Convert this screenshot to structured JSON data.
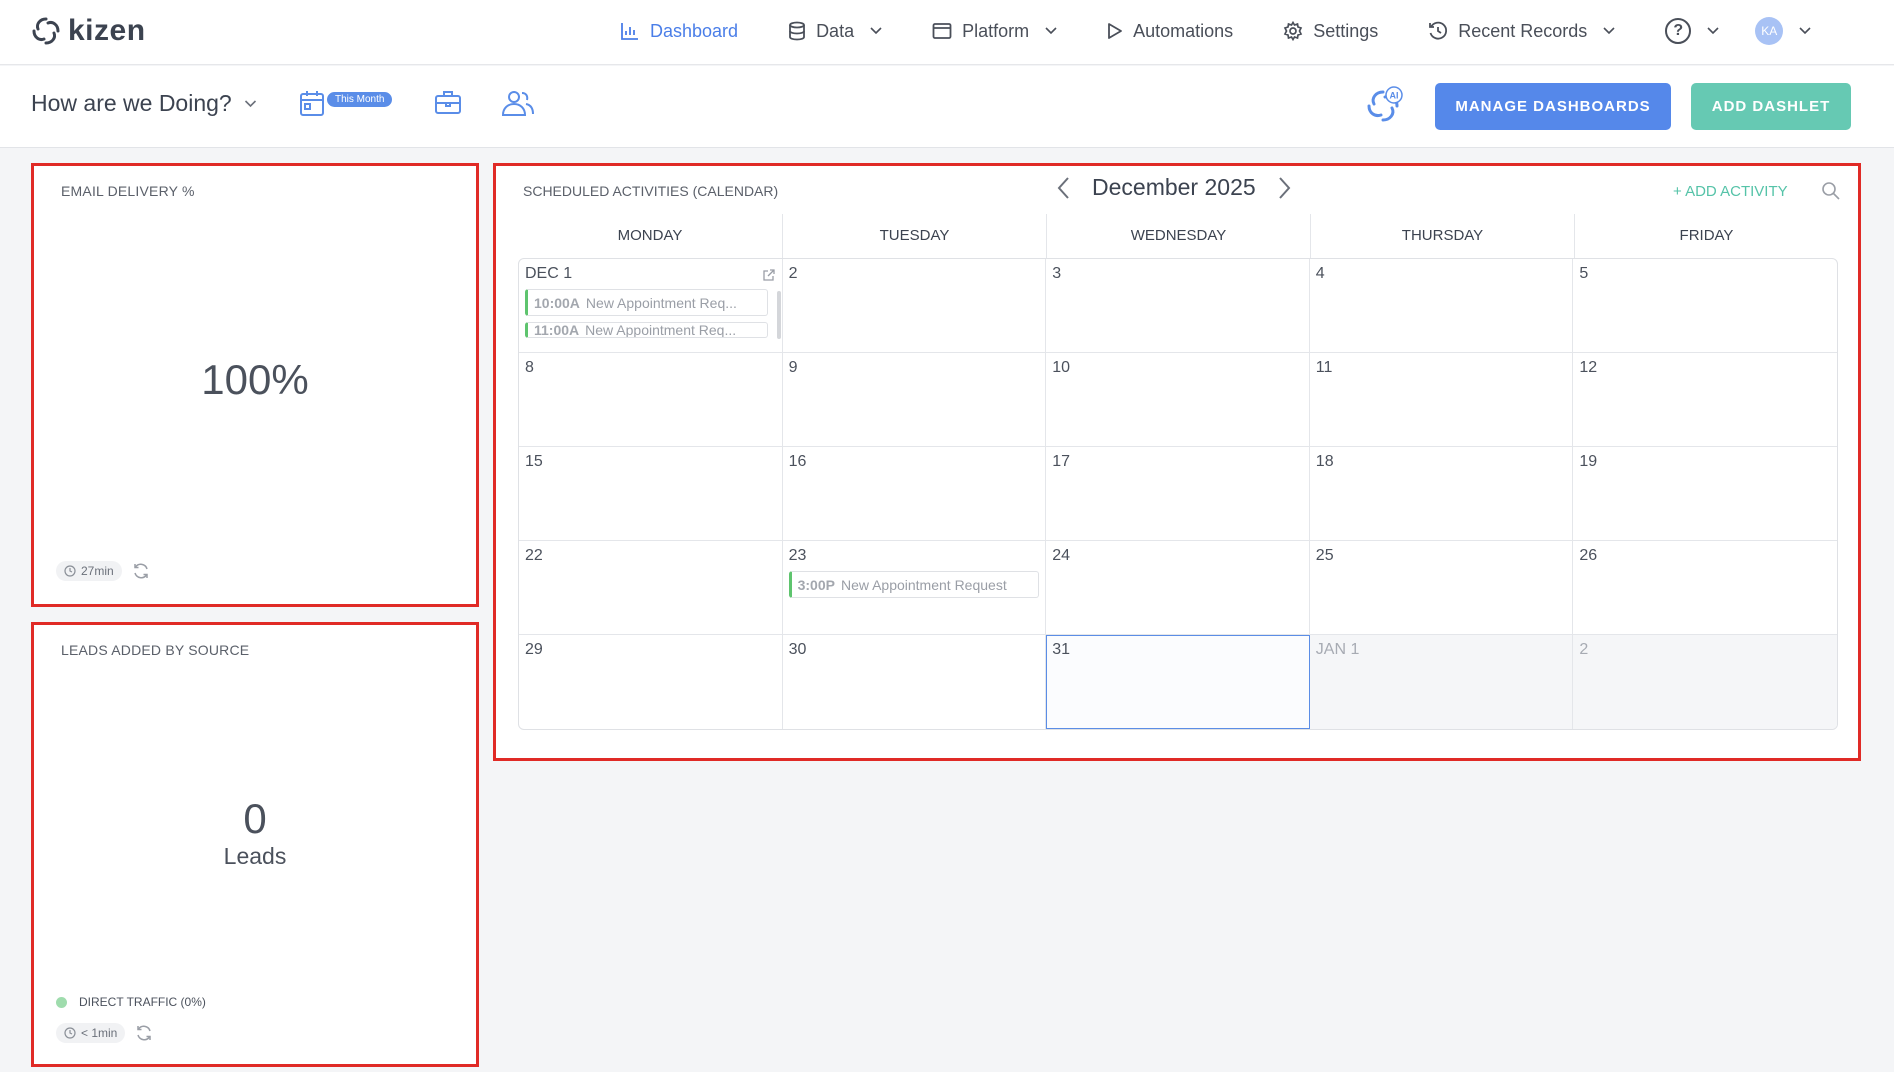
{
  "app": {
    "brand": "kizen"
  },
  "nav": {
    "items": [
      {
        "label": "Dashboard",
        "icon": "chart-icon",
        "active": true,
        "dropdown": false
      },
      {
        "label": "Data",
        "icon": "database-icon",
        "active": false,
        "dropdown": true
      },
      {
        "label": "Platform",
        "icon": "window-icon",
        "active": false,
        "dropdown": true
      },
      {
        "label": "Automations",
        "icon": "play-icon",
        "active": false,
        "dropdown": false
      },
      {
        "label": "Settings",
        "icon": "gear-icon",
        "active": false,
        "dropdown": false
      },
      {
        "label": "Recent Records",
        "icon": "history-icon",
        "active": false,
        "dropdown": true
      }
    ],
    "help_glyph": "?",
    "avatar_initials": "KA"
  },
  "toolbar": {
    "dashboard_name": "How are we Doing?",
    "date_filter_label": "This Month",
    "manage_label": "MANAGE DASHBOARDS",
    "add_label": "ADD DASHLET"
  },
  "dashlets": {
    "email": {
      "title": "EMAIL DELIVERY %",
      "value": "100%",
      "refresh_age": "27min"
    },
    "leads": {
      "title": "LEADS ADDED BY SOURCE",
      "value": "0",
      "unit": "Leads",
      "legend_label": "DIRECT TRAFFIC (0%)",
      "legend_color": "#9fdcad",
      "refresh_age": "< 1min"
    }
  },
  "calendar": {
    "title": "SCHEDULED ACTIVITIES (CALENDAR)",
    "month": "December 2025",
    "add_label": "+ ADD ACTIVITY",
    "weekdays": [
      "MONDAY",
      "TUESDAY",
      "WEDNESDAY",
      "THURSDAY",
      "FRIDAY"
    ],
    "days": [
      {
        "label": "DEC 1",
        "events": [
          {
            "time": "10:00A",
            "title": "New Appointment Req..."
          },
          {
            "time": "11:00A",
            "title": "New Appointment Req..."
          }
        ]
      },
      {
        "label": "2"
      },
      {
        "label": "3"
      },
      {
        "label": "4"
      },
      {
        "label": "5"
      },
      {
        "label": "8"
      },
      {
        "label": "9"
      },
      {
        "label": "10"
      },
      {
        "label": "11"
      },
      {
        "label": "12"
      },
      {
        "label": "15"
      },
      {
        "label": "16"
      },
      {
        "label": "17"
      },
      {
        "label": "18"
      },
      {
        "label": "19"
      },
      {
        "label": "22"
      },
      {
        "label": "23",
        "events": [
          {
            "time": "3:00P",
            "title": "New Appointment Request"
          }
        ]
      },
      {
        "label": "24"
      },
      {
        "label": "25"
      },
      {
        "label": "26"
      },
      {
        "label": "29"
      },
      {
        "label": "30"
      },
      {
        "label": "31",
        "today": true
      },
      {
        "label": "JAN 1",
        "other": true
      },
      {
        "label": "2",
        "other": true
      }
    ]
  },
  "colors": {
    "accent_blue": "#5588ea",
    "accent_green": "#66c9b3",
    "highlight_border": "#e02a26",
    "event_bar": "#5ec46e"
  }
}
